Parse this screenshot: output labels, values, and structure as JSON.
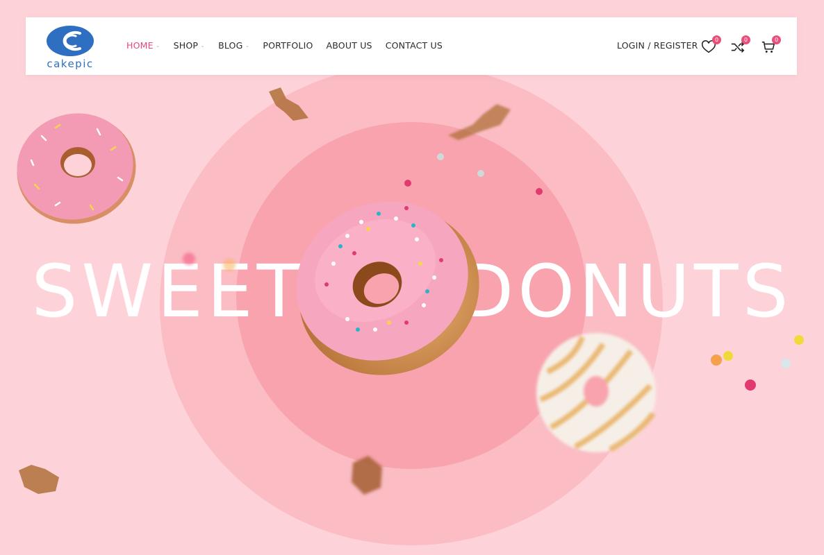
{
  "brand": {
    "name": "cakepic"
  },
  "nav": {
    "items": [
      {
        "label": "HOME",
        "dropdown": true,
        "active": true
      },
      {
        "label": "SHOP",
        "dropdown": true,
        "active": false
      },
      {
        "label": "BLOG",
        "dropdown": true,
        "active": false
      },
      {
        "label": "PORTFOLIO",
        "dropdown": false,
        "active": false
      },
      {
        "label": "ABOUT US",
        "dropdown": false,
        "active": false
      },
      {
        "label": "CONTACT US",
        "dropdown": false,
        "active": false
      }
    ],
    "login_label": "LOGIN / REGISTER",
    "wishlist_count": "0",
    "compare_count": "0",
    "cart_count": "0"
  },
  "hero": {
    "word1": "SWEET",
    "word2": "DONUTS"
  },
  "colors": {
    "accent": "#e8457a",
    "background": "#fdd3d9",
    "circle_outer": "#fbbcc4",
    "circle_inner": "#f8a3ad",
    "logo_blue": "#2f6fc1"
  },
  "icons": [
    "heart-icon",
    "shuffle-icon",
    "cart-icon"
  ]
}
